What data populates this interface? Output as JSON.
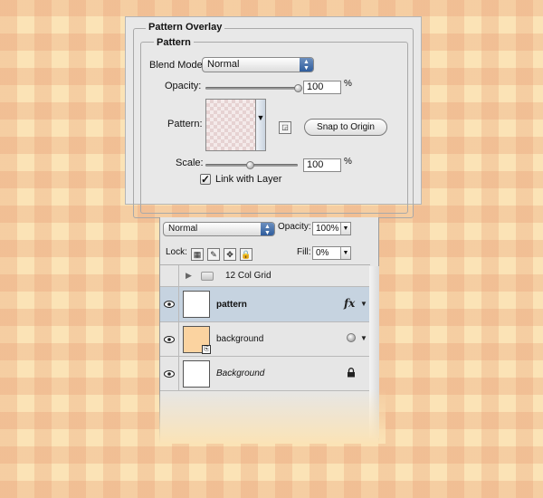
{
  "pattern_overlay": {
    "title": "Pattern Overlay",
    "group_title": "Pattern",
    "blend_mode_label": "Blend Mode:",
    "blend_mode_value": "Normal",
    "opacity_label": "Opacity:",
    "opacity_value": "100",
    "opacity_level": 1.0,
    "percent_sign": "%",
    "pattern_label": "Pattern:",
    "snap_button": "Snap to Origin",
    "scale_label": "Scale:",
    "scale_value": "100",
    "scale_level": 0.49,
    "link_with_layer_label": "Link with Layer",
    "link_with_layer_checked": true
  },
  "layers_panel": {
    "blend_mode_value": "Normal",
    "opacity_label": "Opacity:",
    "opacity_value": "100%",
    "lock_label": "Lock:",
    "fill_label": "Fill:",
    "fill_value": "0%",
    "layers": [
      {
        "name": "12 Col Grid",
        "type": "group",
        "visible": false,
        "selected": false
      },
      {
        "name": "pattern",
        "type": "layer",
        "visible": true,
        "selected": true,
        "fx": "fx",
        "thumb_color": "#ffffff"
      },
      {
        "name": "background",
        "type": "layer",
        "visible": true,
        "selected": false,
        "thumb_color": "#fbd3a0"
      },
      {
        "name": "Background",
        "type": "background",
        "visible": true,
        "selected": false,
        "locked": true,
        "thumb_color": "#ffffff"
      }
    ],
    "selected_row_color": "#c6d3e0"
  }
}
